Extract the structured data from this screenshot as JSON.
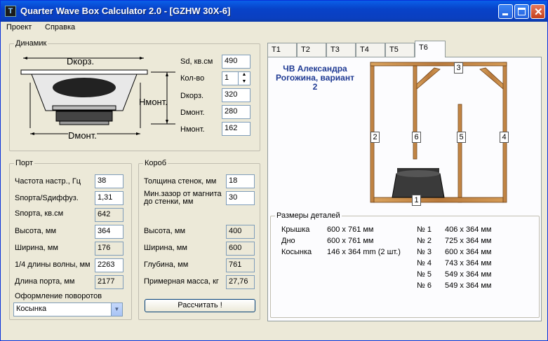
{
  "window": {
    "title": "Quarter Wave Box Calculator 2.0 - [GZHW 30X-6]",
    "app_icon": "T"
  },
  "menu": [
    "Проект",
    "Справка"
  ],
  "speaker": {
    "legend": "Динамик",
    "diagram_labels": {
      "dkorz": "Dкорз.",
      "hmont": "Hмонт.",
      "dmont": "Dмонт."
    },
    "fields": [
      {
        "label": "Sd, кв.см",
        "value": "490"
      },
      {
        "label": "Кол-во",
        "value": "1"
      },
      {
        "label": "Dкорз.",
        "value": "320"
      },
      {
        "label": "Dмонт.",
        "value": "280"
      },
      {
        "label": "Hмонт.",
        "value": "162"
      }
    ]
  },
  "port": {
    "legend": "Порт",
    "fields": [
      {
        "label": "Частота настр., Гц",
        "value": "38"
      },
      {
        "label": "Sпорта/Sдиффуз.",
        "value": "1,31"
      },
      {
        "label": "Sпорта, кв.см",
        "value": "642"
      },
      {
        "label": "Высота, мм",
        "value": "364"
      },
      {
        "label": "Ширина, мм",
        "value": "176"
      },
      {
        "label": "1/4 длины волны, мм",
        "value": "2263"
      },
      {
        "label": "Длина порта, мм",
        "value": "2177"
      }
    ],
    "turns_label": "Оформление поворотов",
    "turns_value": "Косынка"
  },
  "box": {
    "legend": "Короб",
    "fields": [
      {
        "label": "Толщина стенок, мм",
        "value": "18"
      },
      {
        "label": "Мин.зазор от магнита до стенки, мм",
        "value": "30"
      },
      {
        "label": "Высота, мм",
        "value": "400"
      },
      {
        "label": "Ширина, мм",
        "value": "600"
      },
      {
        "label": "Глубина, мм",
        "value": "761"
      },
      {
        "label": "Примерная масса, кг",
        "value": "27,76"
      }
    ],
    "calc_button": "Рассчитать !"
  },
  "tabs": [
    "T1",
    "T2",
    "T3",
    "T4",
    "T5",
    "T6"
  ],
  "active_tab": "T6",
  "panel": {
    "author": "ЧВ Александра Рогожина, вариант 2",
    "part_numbers": [
      "1",
      "2",
      "3",
      "4",
      "5",
      "6"
    ],
    "dims_legend": "Размеры деталей",
    "dims_left": [
      {
        "name": "Крышка",
        "size": "600 х 761 мм"
      },
      {
        "name": "Дно",
        "size": "600 х 761 мм"
      },
      {
        "name": "Косынка",
        "size": "146 x 364 mm (2 шт.)"
      }
    ],
    "dims_right": [
      {
        "num": "№ 1",
        "size": "406 х 364 мм"
      },
      {
        "num": "№ 2",
        "size": "725 х 364 мм"
      },
      {
        "num": "№ 3",
        "size": "600 х 364 мм"
      },
      {
        "num": "№ 4",
        "size": "743 х 364 мм"
      },
      {
        "num": "№ 5",
        "size": "549 х 364 мм"
      },
      {
        "num": "№ 6",
        "size": "549 х 364 мм"
      }
    ]
  },
  "colors": {
    "title_bar": "#0a50d8",
    "author_text": "#1f3a93",
    "wood": "#c98a4a"
  }
}
